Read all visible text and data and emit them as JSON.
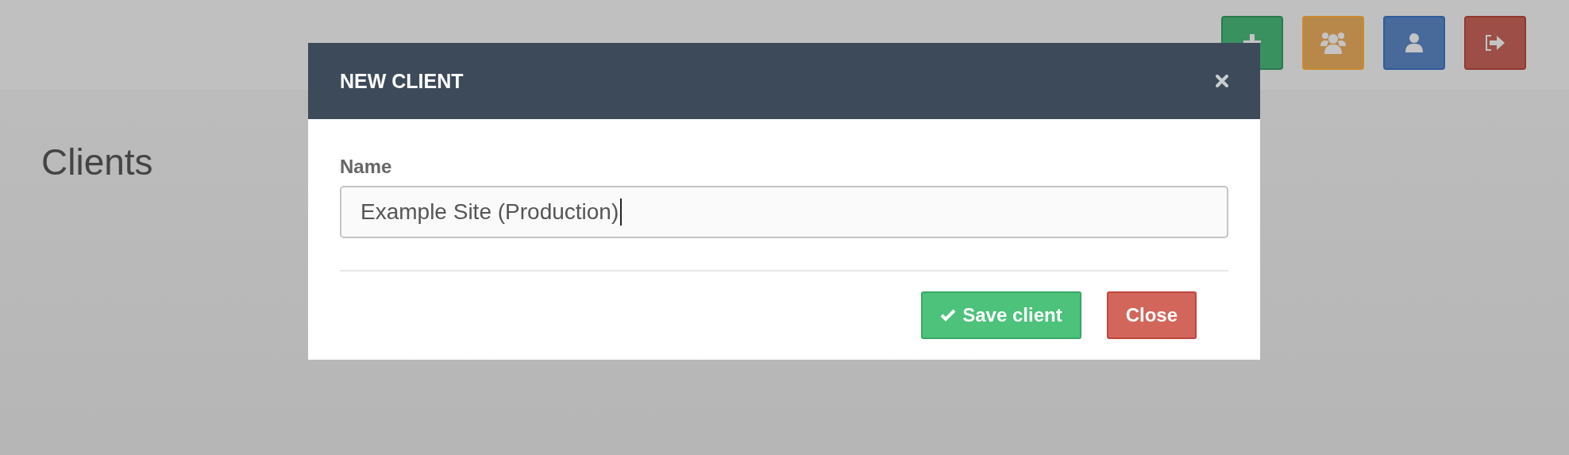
{
  "toolbar": [
    {
      "kind": "add",
      "color": "#3a9160"
    },
    {
      "kind": "group",
      "color": "#b8884a"
    },
    {
      "kind": "user",
      "color": "#476a9a"
    },
    {
      "kind": "logout",
      "color": "#9d4f47"
    }
  ],
  "page_title": "Clients",
  "modal": {
    "title": "NEW CLIENT",
    "field": {
      "label": "Name",
      "value": "Example Site (Production)",
      "focused": true
    },
    "buttons": [
      {
        "label": "Save client",
        "kind": "save"
      },
      {
        "label": "Close",
        "kind": "close"
      }
    ]
  }
}
